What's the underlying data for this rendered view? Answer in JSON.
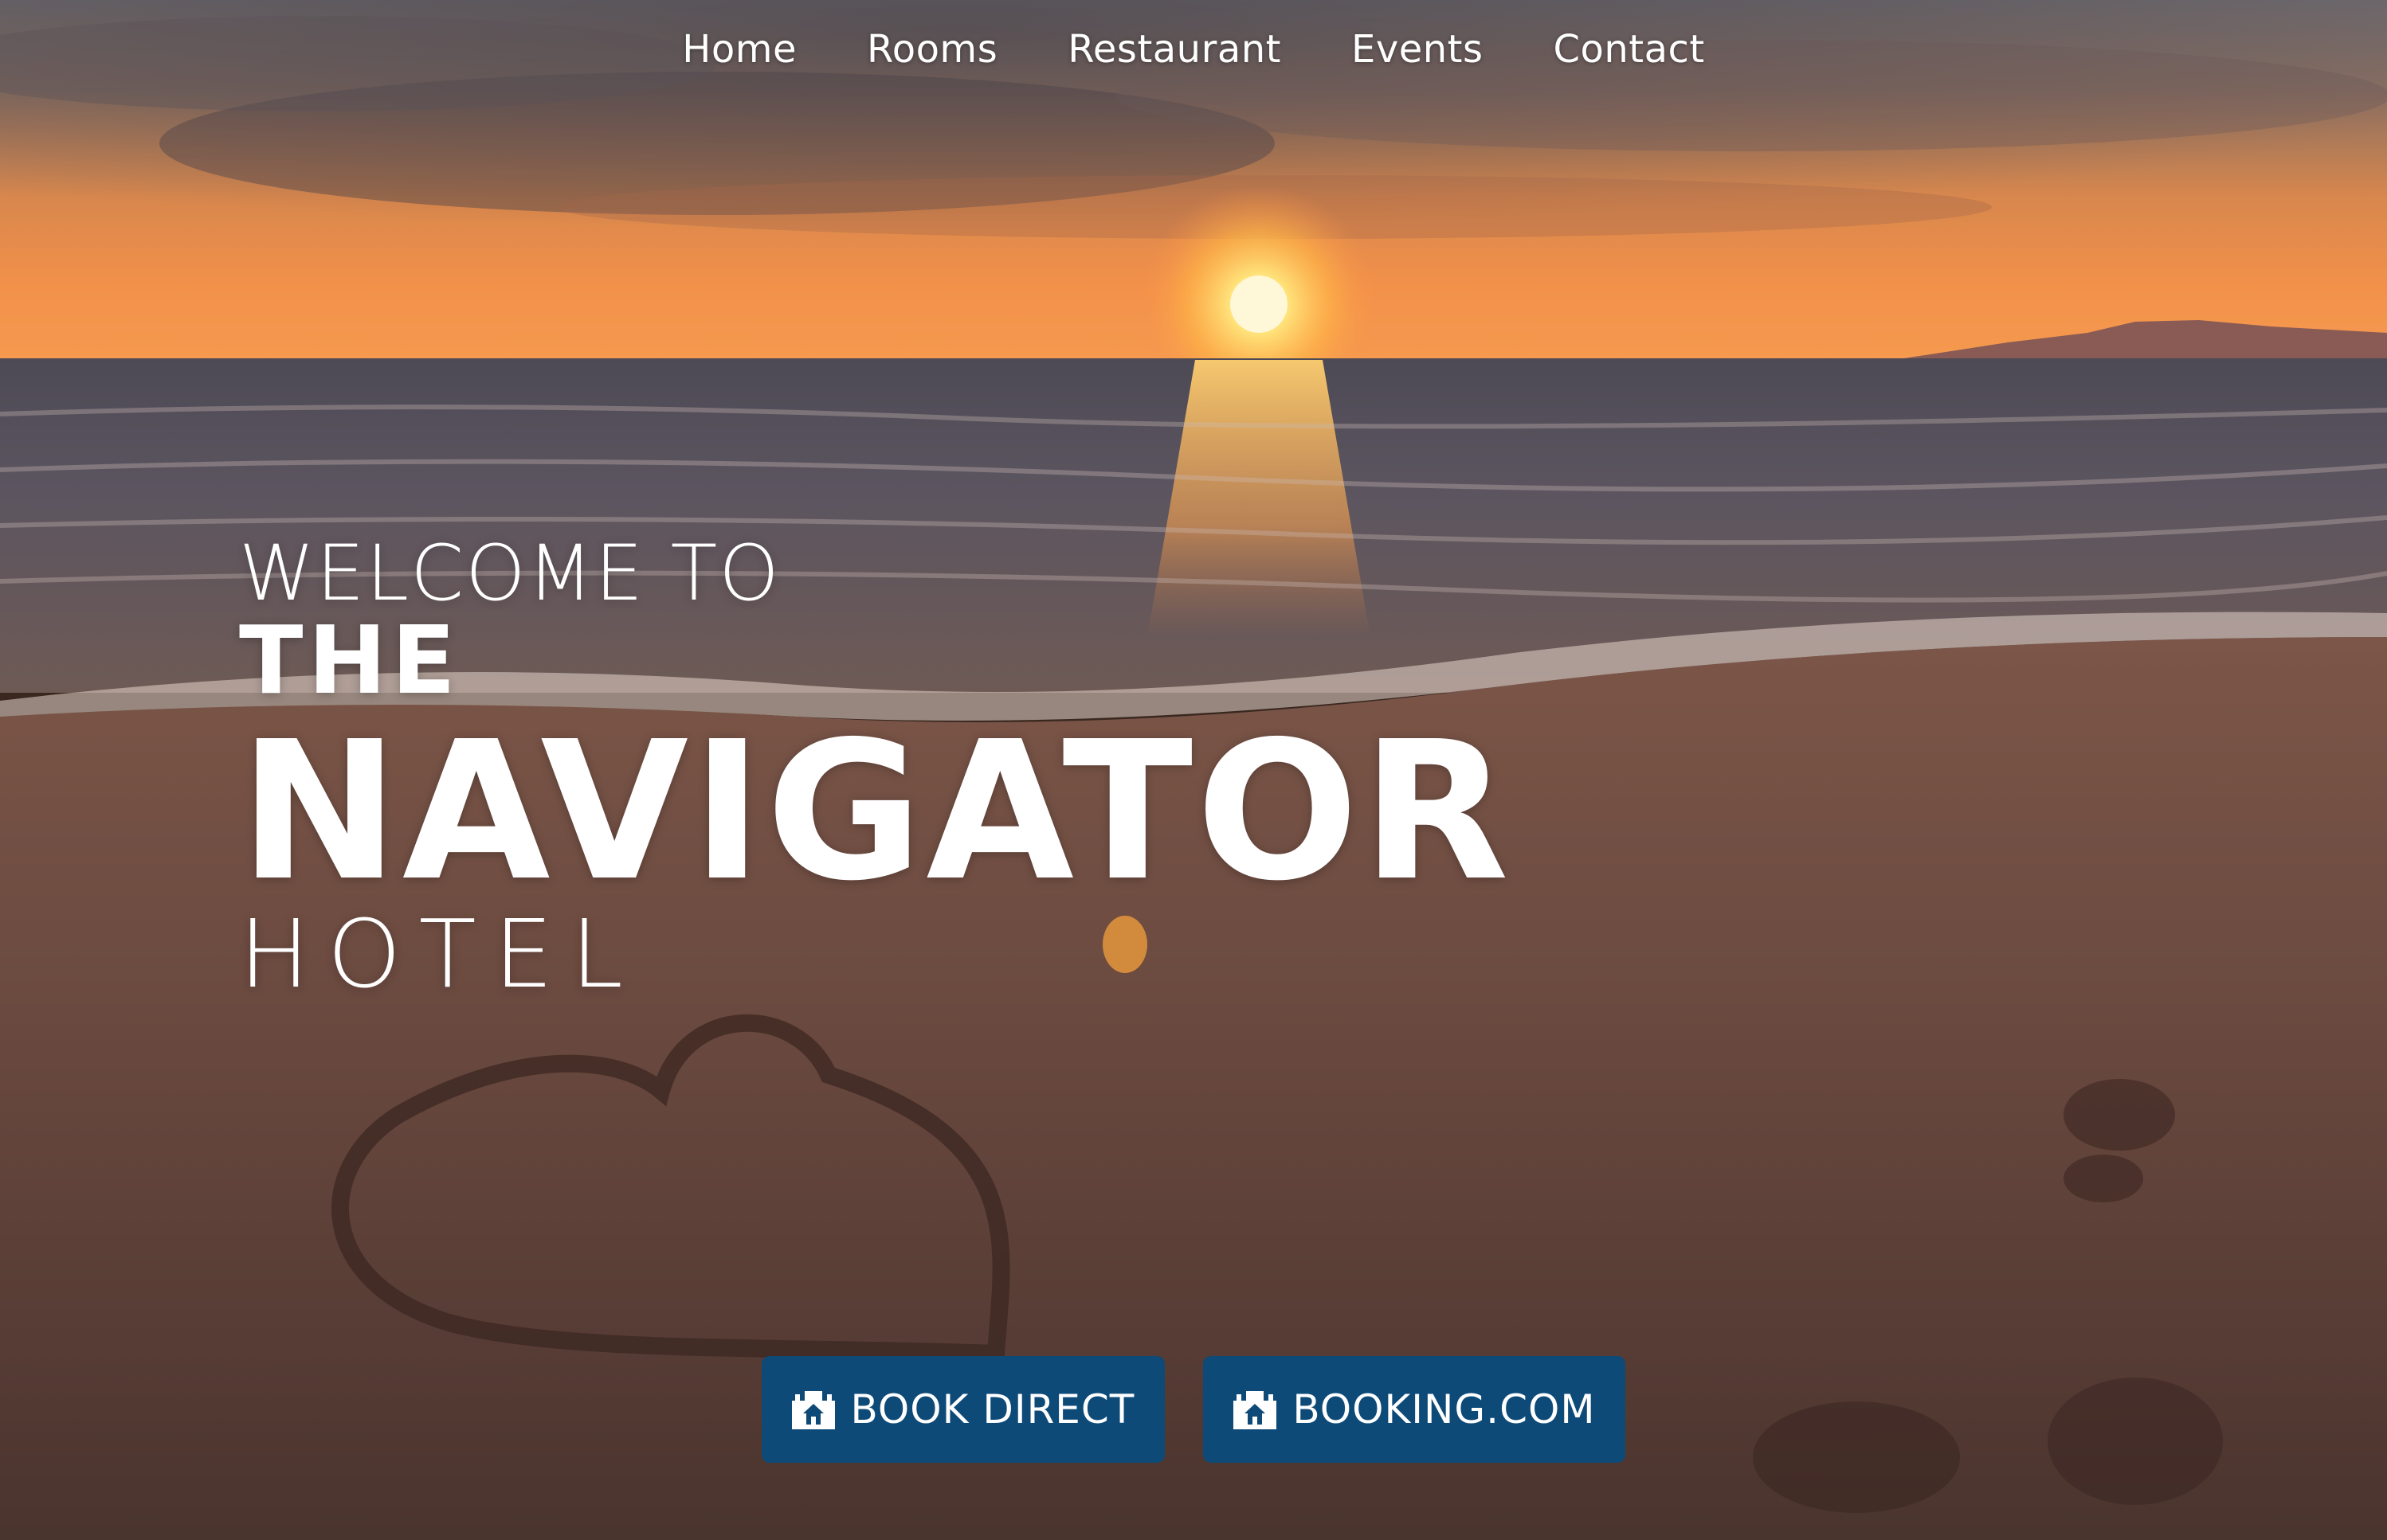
{
  "nav": {
    "items": [
      {
        "label": "Home"
      },
      {
        "label": "Rooms"
      },
      {
        "label": "Restaurant"
      },
      {
        "label": "Events"
      },
      {
        "label": "Contact"
      }
    ]
  },
  "hero": {
    "welcome": "WELCOME TO",
    "the": "THE",
    "name": "NAVIGATOR",
    "hotel": "HOTEL"
  },
  "buttons": {
    "book_direct": {
      "label": "BOOK DIRECT",
      "icon": "hotel-icon"
    },
    "booking_com": {
      "label": "BOOKING.COM",
      "icon": "hotel-icon"
    }
  },
  "colors": {
    "button_bg": "#0d4a78",
    "text": "#ffffff"
  }
}
